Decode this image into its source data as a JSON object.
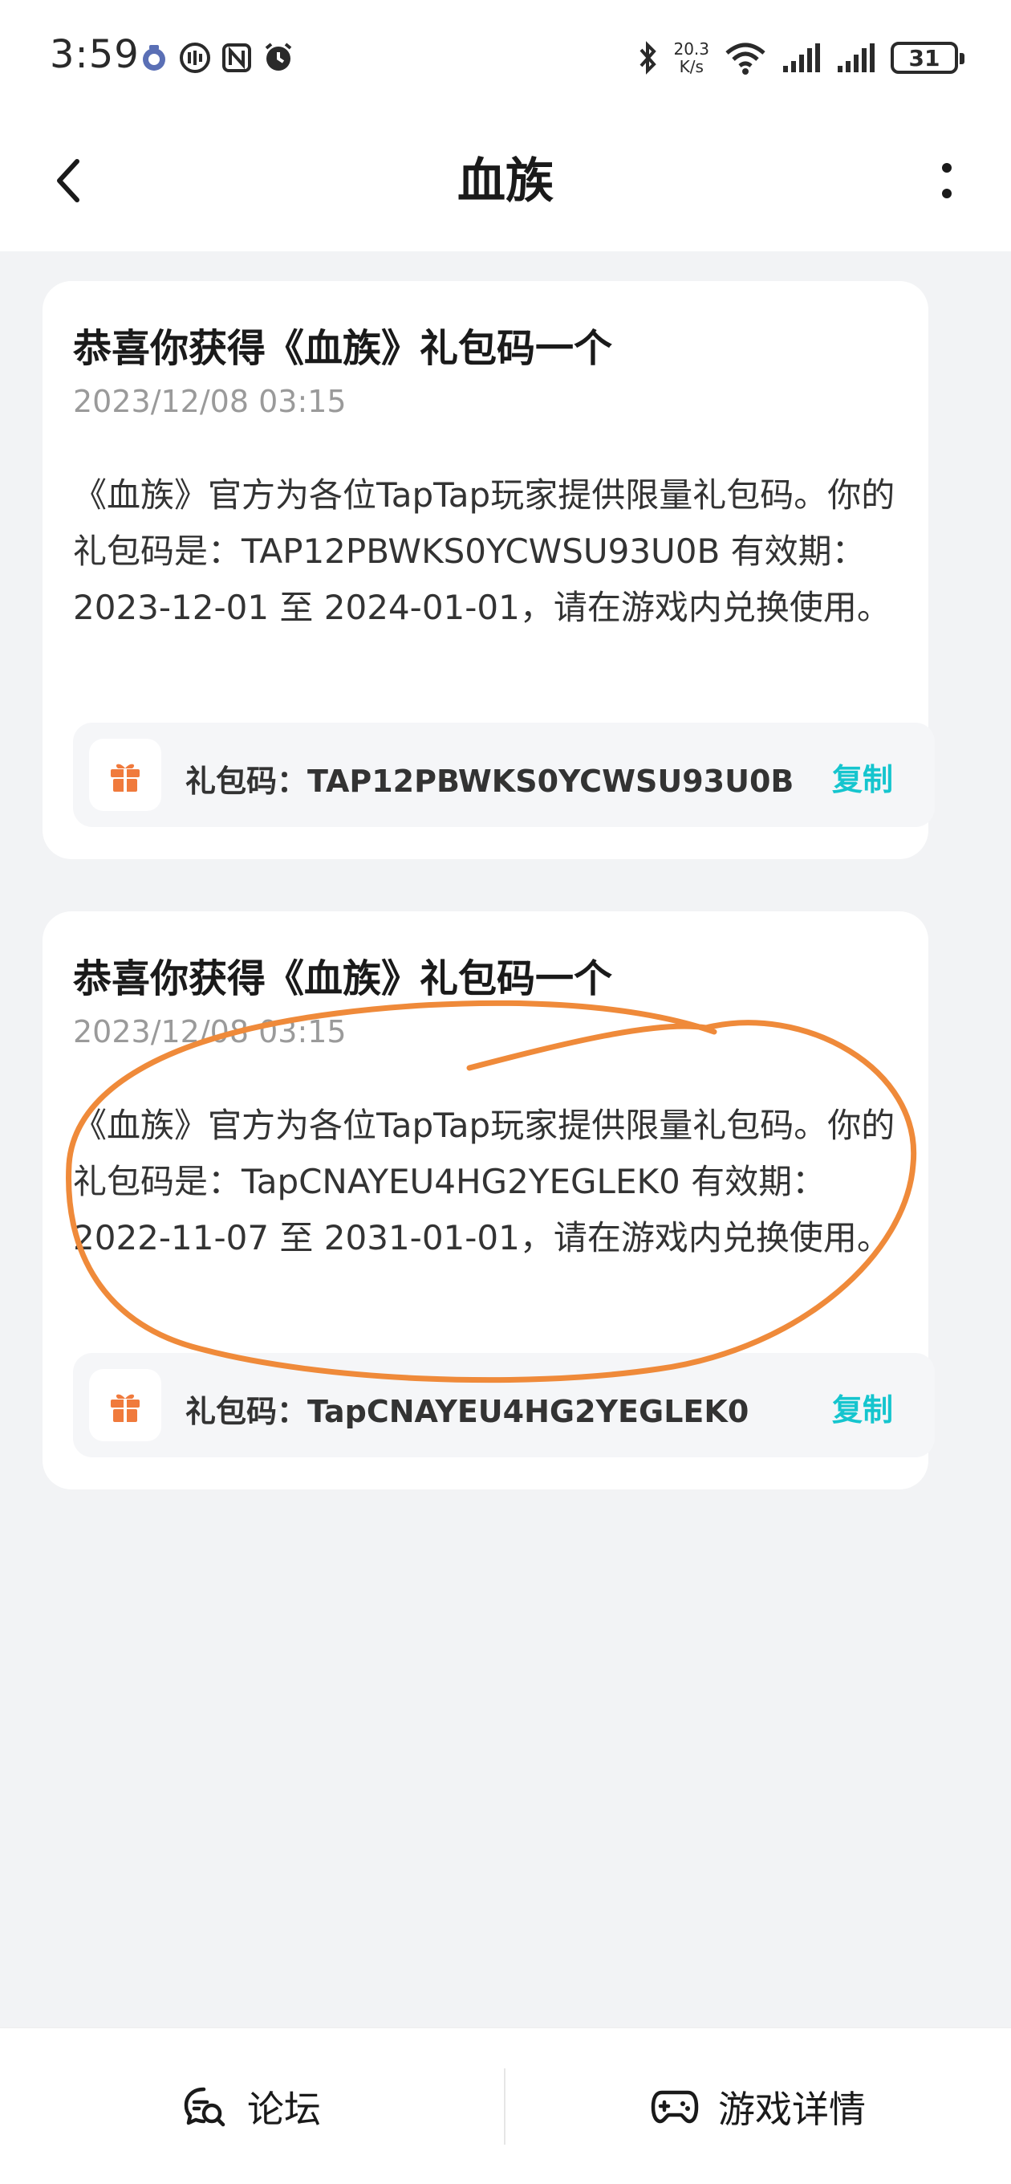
{
  "status_bar": {
    "time": "3:59",
    "net_speed_value": "20.3",
    "net_speed_unit": "K/s",
    "battery_level": "31",
    "left_icons": [
      "app-notification-icon",
      "circle-app-icon",
      "nfc-icon",
      "alarm-icon"
    ],
    "right_icons": [
      "bluetooth-icon",
      "wifi-icon",
      "signal-icon",
      "signal-icon"
    ]
  },
  "nav": {
    "title": "血族",
    "back_icon": "chevron-left-icon",
    "more_icon": "more-vertical-icon"
  },
  "messages": [
    {
      "title": "恭喜你获得《血族》礼包码一个",
      "date": "2023/12/08 03:15",
      "body": "《血族》官方为各位TapTap玩家提供限量礼包码。你的礼包码是：TAP12PBWKS0YCWSU93U0B 有效期：2023-12-01 至 2024-01-01，请在游戏内兑换使用。",
      "code_label": "礼包码：TAP12PBWKS0YCWSU93U0B",
      "copy_label": "复制"
    },
    {
      "title": "恭喜你获得《血族》礼包码一个",
      "date": "2023/12/08 03:15",
      "body": "《血族》官方为各位TapTap玩家提供限量礼包码。你的礼包码是：TapCNAYEU4HG2YEGLEK0 有效期：2022-11-07 至 2031-01-01，请在游戏内兑换使用。",
      "code_label": "礼包码：TapCNAYEU4HG2YEGLEK0",
      "copy_label": "复制"
    }
  ],
  "bottom_bar": {
    "forum_label": "论坛",
    "game_details_label": "游戏详情"
  },
  "colors": {
    "accent": "#15c5ce",
    "gift": "#f07a3c",
    "annotation": "#ef8a3a",
    "background": "#f2f3f5"
  }
}
